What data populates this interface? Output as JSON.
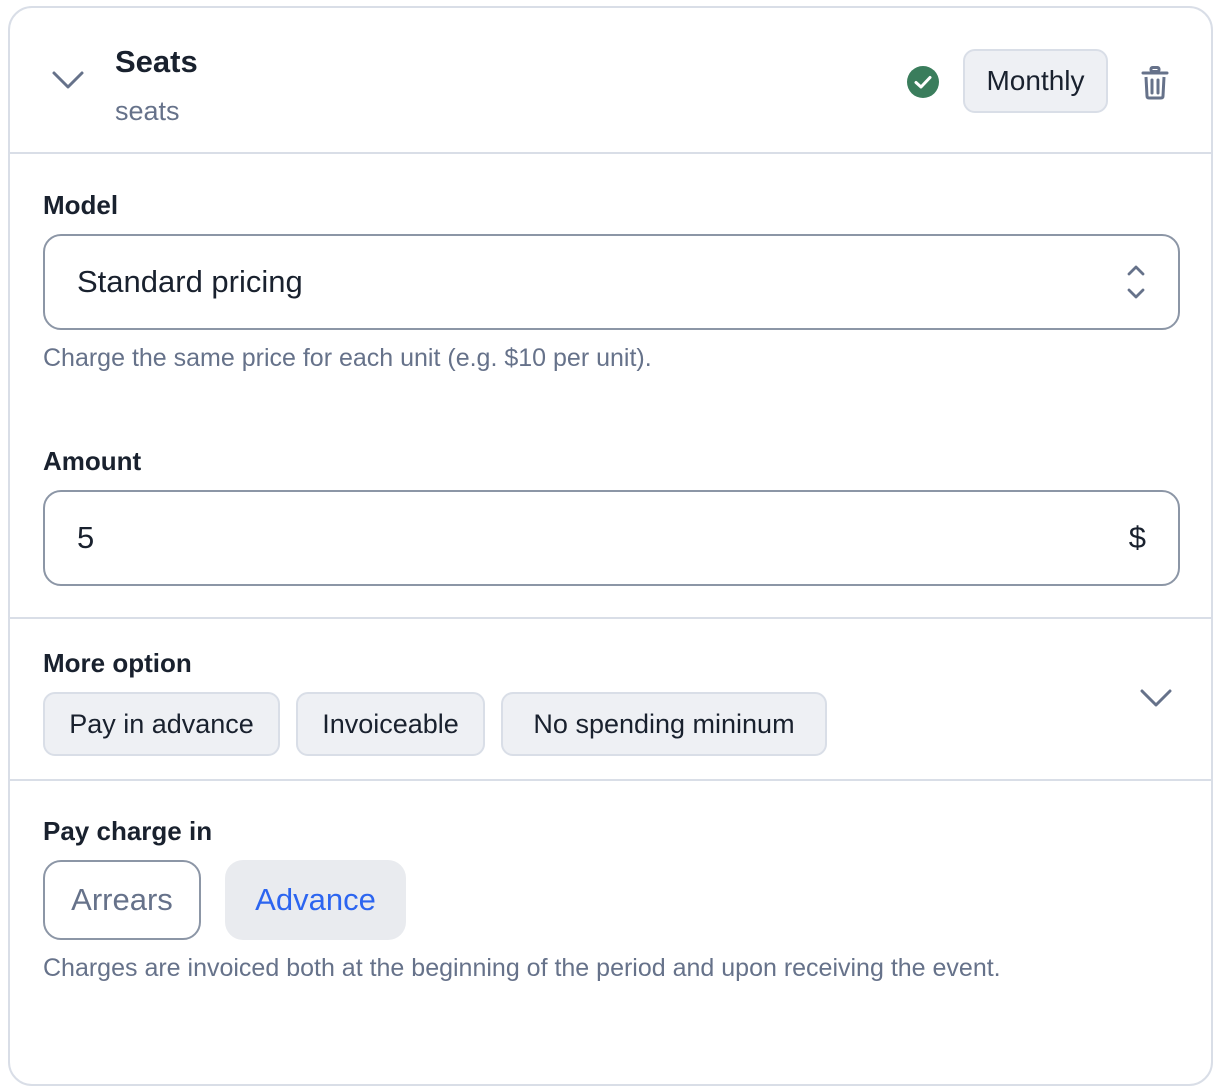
{
  "charge": {
    "title": "Seats",
    "code": "seats",
    "status": "check-circle-icon",
    "interval": "Monthly"
  },
  "model": {
    "label": "Model",
    "value": "Standard pricing",
    "helper": "Charge the same price for each unit (e.g. $10 per unit)."
  },
  "amount": {
    "label": "Amount",
    "value": "5",
    "currency_symbol": "$"
  },
  "more_options": {
    "label": "More option",
    "chips": [
      "Pay in advance",
      "Invoiceable",
      "No spending mininum"
    ]
  },
  "pay_charge": {
    "label": "Pay charge in",
    "options": [
      "Arrears",
      "Advance"
    ],
    "selected": "Advance",
    "helper": "Charges are invoiced both at the beginning of the period and upon receiving the event."
  },
  "colors": {
    "success": "#3a7d5c",
    "accent": "#2c65f0",
    "muted_text": "#66728a",
    "border": "#d9dee7"
  }
}
